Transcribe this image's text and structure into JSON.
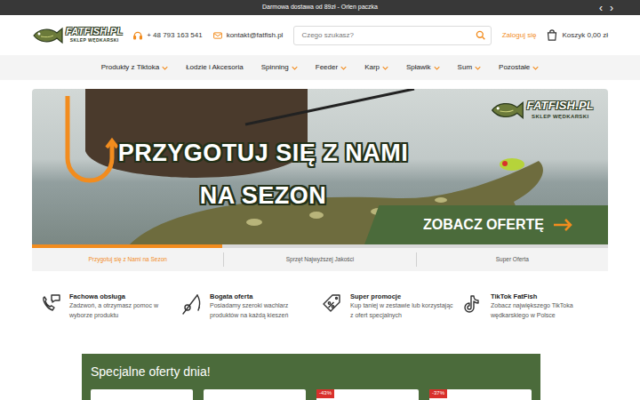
{
  "topbar": {
    "text": "Darmowa dostawa od 89zł - Orlen paczka",
    "prev": "‹",
    "next": "›"
  },
  "header": {
    "logo": {
      "name": "FATFISH.PL",
      "tagline": "SKLEP WĘDKARSKI"
    },
    "phone": "+ 48 793 163 541",
    "email": "kontakt@fatfish.pl",
    "search": {
      "placeholder": "Czego szukasz?"
    },
    "login": "Zaloguj się",
    "cart": "Koszyk 0,00 zł"
  },
  "nav": [
    {
      "label": "Produkty z Tiktoka",
      "dropdown": true
    },
    {
      "label": "Łodzie i Akcesoria",
      "dropdown": false
    },
    {
      "label": "Spinning",
      "dropdown": true
    },
    {
      "label": "Feeder",
      "dropdown": true
    },
    {
      "label": "Karp",
      "dropdown": true
    },
    {
      "label": "Spławik",
      "dropdown": true
    },
    {
      "label": "Sum",
      "dropdown": true
    },
    {
      "label": "Pozostałe",
      "dropdown": true
    }
  ],
  "banner": {
    "headline": [
      "PRZYGOTUJ SIĘ Z NAMI",
      "NA SEZON"
    ],
    "cta": "ZOBACZ OFERTĘ",
    "logo": {
      "name": "FATFISH.PL",
      "tagline": "SKLEP WĘDKARSKI"
    }
  },
  "slider": {
    "level": 0.33,
    "tabs": [
      {
        "label": "Przygotuj się z Nami na Sezon",
        "selected": true
      },
      {
        "label": "Sprzęt Najwyższej Jakości",
        "selected": false
      },
      {
        "label": "Super Oferta",
        "selected": false
      }
    ]
  },
  "features": [
    {
      "title": "Fachowa obsługa",
      "text": "Zadzwoń, a otrzymasz pomoc w wyborze produktu"
    },
    {
      "title": "Bogata oferta",
      "text": "Posiadamy szeroki wachlarz produktów na każdą kieszeń"
    },
    {
      "title": "Super promocje",
      "text": "Kup taniej w zestawie lub korzystając z ofert specjalnych"
    },
    {
      "title": "TikTok FatFish",
      "text": "Zobacz największego TikToka wędkarskiego w Polsce"
    }
  ],
  "offers": {
    "title": "Specjalne oferty dnia!",
    "cards": [
      {
        "kind": "plain"
      },
      {
        "kind": "plain"
      },
      {
        "kind": "discount",
        "badge": "-43%"
      },
      {
        "kind": "discount",
        "badge": "-37%"
      }
    ]
  }
}
